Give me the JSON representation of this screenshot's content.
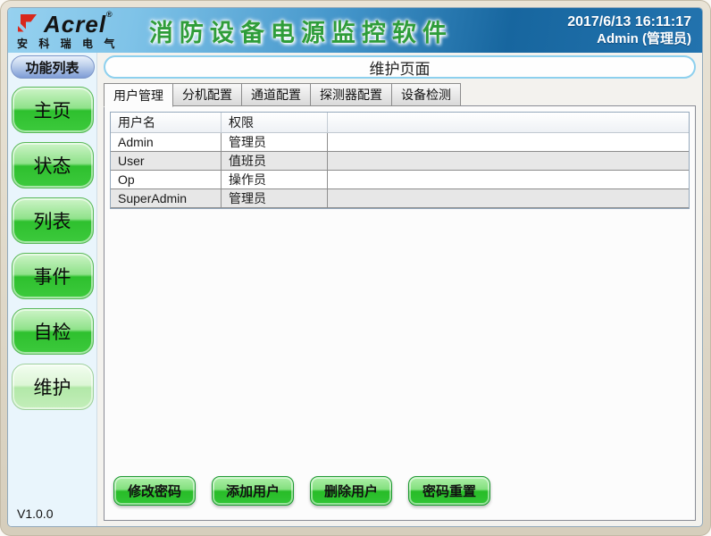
{
  "header": {
    "brand": "Acrel",
    "brand_reg": "®",
    "brand_subtitle": "安 科 瑞 电 气",
    "title": "消防设备电源监控软件",
    "datetime": "2017/6/13 16:11:17",
    "user": "Admin (管理员)"
  },
  "sidebar": {
    "header": "功能列表",
    "items": [
      {
        "label": "主页",
        "active": false
      },
      {
        "label": "状态",
        "active": false
      },
      {
        "label": "列表",
        "active": false
      },
      {
        "label": "事件",
        "active": false
      },
      {
        "label": "自检",
        "active": false
      },
      {
        "label": "维护",
        "active": true
      }
    ],
    "version": "V1.0.0"
  },
  "main": {
    "page_title": "维护页面",
    "tabs": [
      {
        "label": "用户管理",
        "active": true
      },
      {
        "label": "分机配置",
        "active": false
      },
      {
        "label": "通道配置",
        "active": false
      },
      {
        "label": "探测器配置",
        "active": false
      },
      {
        "label": "设备检测",
        "active": false
      }
    ],
    "table": {
      "columns": [
        "用户名",
        "权限"
      ],
      "rows": [
        [
          "Admin",
          "管理员"
        ],
        [
          "User",
          "值班员"
        ],
        [
          "Op",
          "操作员"
        ],
        [
          "SuperAdmin",
          "管理员"
        ]
      ]
    },
    "actions": [
      "修改密码",
      "添加用户",
      "删除用户",
      "密码重置"
    ]
  },
  "colors": {
    "header_blue_dark": "#17669f",
    "header_blue_light": "#96d1ef",
    "title_green": "#2f9d3a",
    "nav_button_green": "#2ec02e",
    "sidebar_bg": "#e9f5fc",
    "frame_beige": "#ddd5c4",
    "page_title_border": "#8dd0ee"
  }
}
